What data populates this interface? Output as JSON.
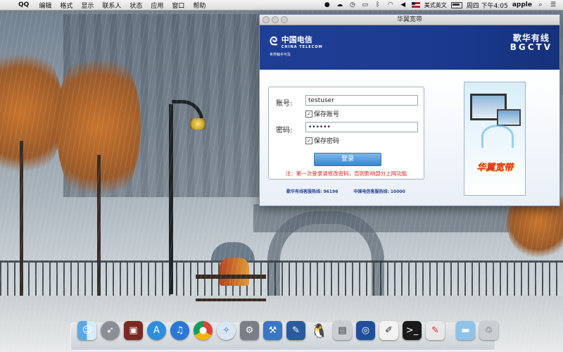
{
  "menubar": {
    "apple_glyph": "",
    "app_name": "QQ",
    "items": [
      "编辑",
      "格式",
      "显示",
      "联系人",
      "状态",
      "应用",
      "窗口",
      "帮助"
    ],
    "input_source": "美式英文",
    "clock": "周四 下午4:05",
    "user": "apple"
  },
  "window": {
    "title": "华翼宽带",
    "telecom": {
      "cn": "中国电信",
      "en": "CHINA TELECOM",
      "slogan": "世界触手可及"
    },
    "bgctv": {
      "cn": "歌华有线",
      "en": "BGCTV"
    },
    "form": {
      "account_label": "账号:",
      "account_value": "testuser",
      "save_account_label": "保存账号",
      "password_label": "密码:",
      "password_value": "••••••",
      "save_password_label": "保存密码",
      "login_label": "登录",
      "note": "注：第一次登录请修改密码，否则影响部分上网功能"
    },
    "hotlines": [
      "歌华有线客服热线: 96196",
      "中国电信客服热线: 10000"
    ],
    "ad_text": "华翼宽带"
  },
  "dock": {
    "icons": [
      "finder-icon",
      "launchpad-icon",
      "photo-booth-icon",
      "app-store-icon",
      "itunes-icon",
      "chrome-icon",
      "safari-icon",
      "system-preferences-icon",
      "xcode-icon",
      "notes-icon",
      "qq-icon",
      "scanner-icon",
      "dictionary-icon",
      "textedit-icon",
      "terminal-icon",
      "preview-icon",
      "folder-icon",
      "trash-icon"
    ]
  },
  "colors": {
    "banner_blue": "#1f3f96",
    "note_red": "#d2241d",
    "login_blue": "#3a86cc"
  }
}
